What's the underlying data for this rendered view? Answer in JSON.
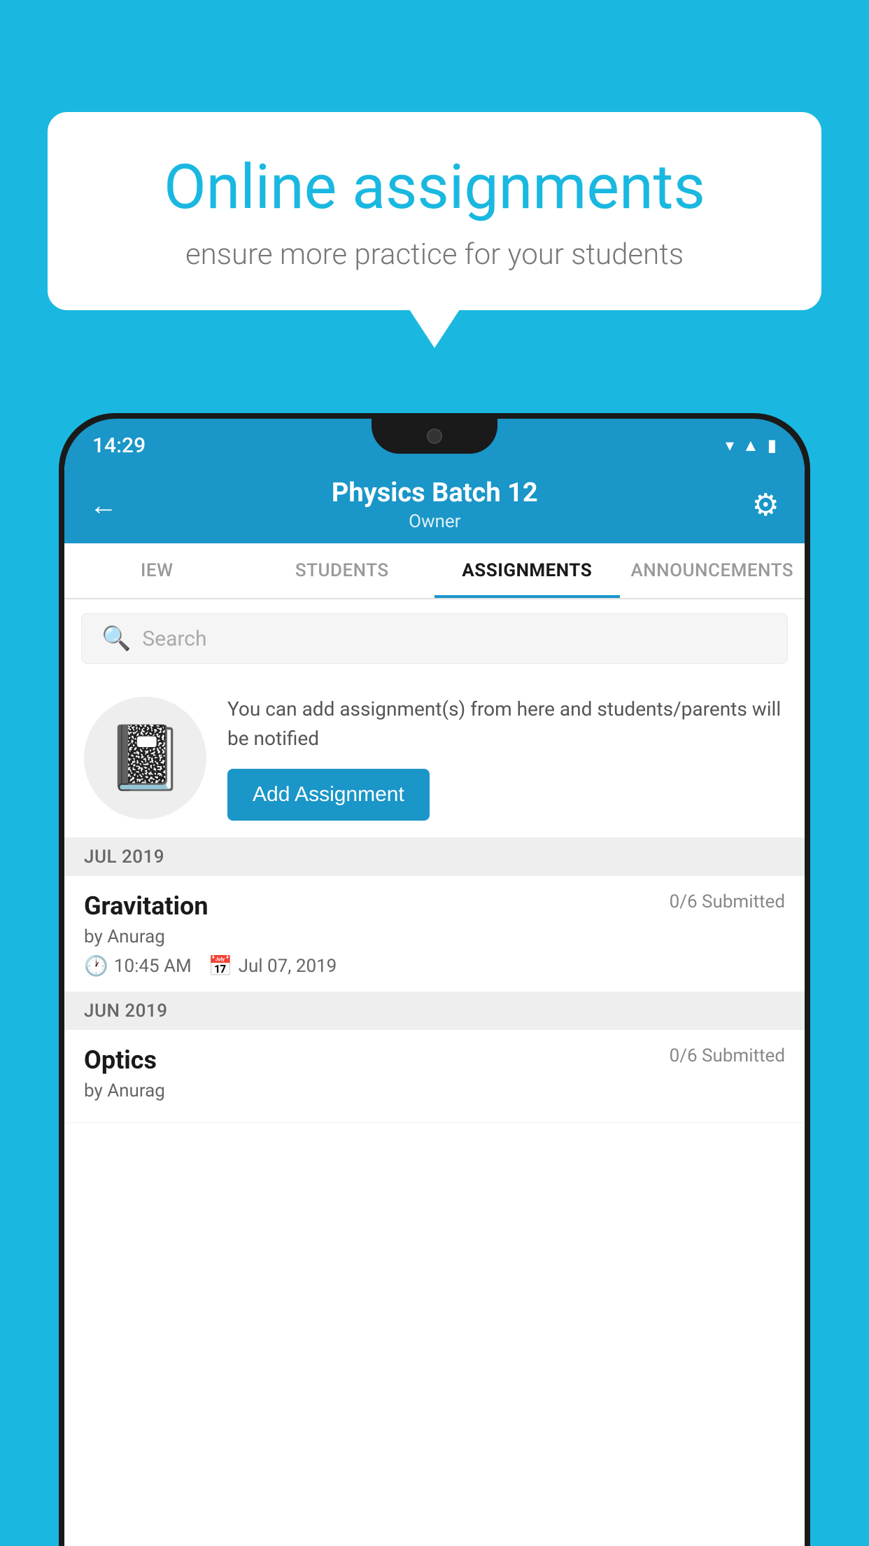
{
  "background_color": "#1AB8E0",
  "speech_bubble": {
    "title": "Online assignments",
    "subtitle": "ensure more practice for your students"
  },
  "phone": {
    "status_bar": {
      "time": "14:29",
      "icons": [
        "wifi",
        "signal",
        "battery"
      ]
    },
    "header": {
      "title": "Physics Batch 12",
      "subtitle": "Owner",
      "back_label": "←",
      "gear_label": "⚙"
    },
    "tabs": [
      {
        "label": "IEW",
        "active": false
      },
      {
        "label": "STUDENTS",
        "active": false
      },
      {
        "label": "ASSIGNMENTS",
        "active": true
      },
      {
        "label": "ANNOUNCEMENTS",
        "active": false
      }
    ],
    "search": {
      "placeholder": "Search"
    },
    "promo": {
      "text": "You can add assignment(s) from here and students/parents will be notified",
      "button_label": "Add Assignment"
    },
    "sections": [
      {
        "label": "JUL 2019",
        "assignments": [
          {
            "title": "Gravitation",
            "status": "0/6 Submitted",
            "by": "by Anurag",
            "time": "10:45 AM",
            "date": "Jul 07, 2019"
          }
        ]
      },
      {
        "label": "JUN 2019",
        "assignments": [
          {
            "title": "Optics",
            "status": "0/6 Submitted",
            "by": "by Anurag",
            "time": "",
            "date": ""
          }
        ]
      }
    ]
  }
}
